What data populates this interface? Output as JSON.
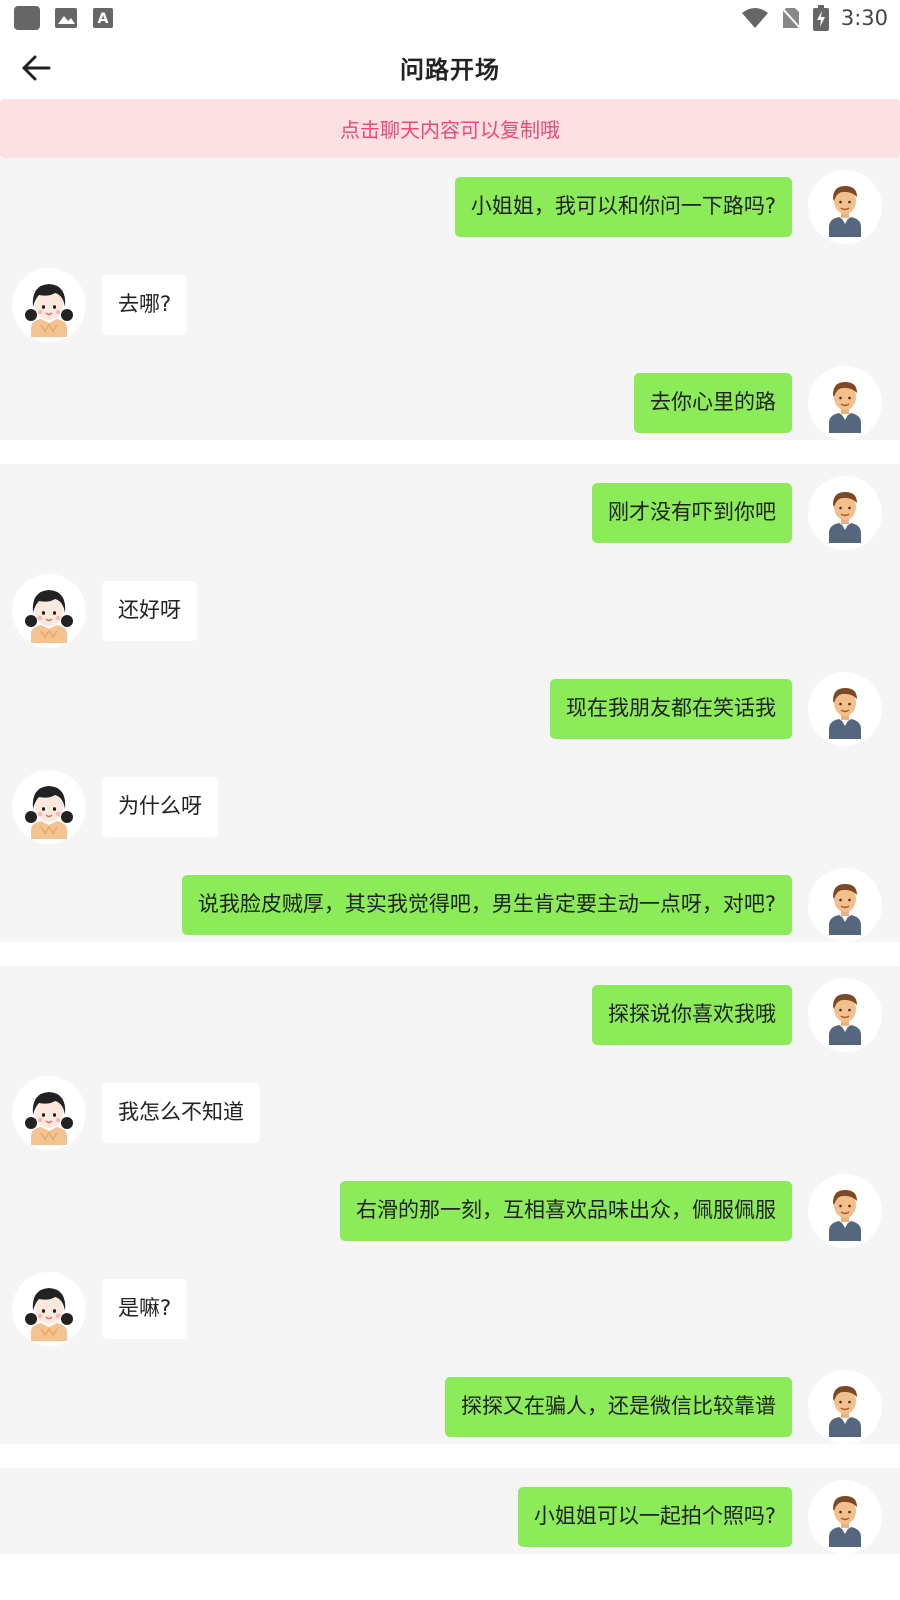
{
  "status_bar": {
    "time": "3:30",
    "left_icons": [
      "app-square-icon",
      "image-icon",
      "text-a-icon"
    ],
    "right_icons": [
      "wifi-icon",
      "no-sim-icon",
      "battery-charging-icon"
    ]
  },
  "header": {
    "title": "问路开场",
    "back_icon": "arrow-left-icon"
  },
  "notice": {
    "text": "点击聊天内容可以复制哦",
    "bg_color": "#fde0e4",
    "text_color": "#ec4a74"
  },
  "colors": {
    "my_bubble": "#8beb58",
    "her_bubble": "#ffffff",
    "group_bg": "#f5f5f5"
  },
  "groups": [
    {
      "messages": [
        {
          "from": "me",
          "text": "小姐姐，我可以和你问一下路吗?"
        },
        {
          "from": "her",
          "text": "去哪?"
        },
        {
          "from": "me",
          "text": "去你心里的路"
        }
      ]
    },
    {
      "messages": [
        {
          "from": "me",
          "text": "刚才没有吓到你吧"
        },
        {
          "from": "her",
          "text": "还好呀"
        },
        {
          "from": "me",
          "text": "现在我朋友都在笑话我"
        },
        {
          "from": "her",
          "text": "为什么呀"
        },
        {
          "from": "me",
          "text": "说我脸皮贼厚，其实我觉得吧，男生肯定要主动一点呀，对吧?"
        }
      ]
    },
    {
      "messages": [
        {
          "from": "me",
          "text": "探探说你喜欢我哦"
        },
        {
          "from": "her",
          "text": "我怎么不知道"
        },
        {
          "from": "me",
          "text": "右滑的那一刻，互相喜欢品味出众，佩服佩服"
        },
        {
          "from": "her",
          "text": "是嘛?"
        },
        {
          "from": "me",
          "text": "探探又在骗人，还是微信比较靠谱"
        }
      ]
    },
    {
      "messages": [
        {
          "from": "me",
          "text": "小姐姐可以一起拍个照吗?"
        }
      ]
    }
  ]
}
